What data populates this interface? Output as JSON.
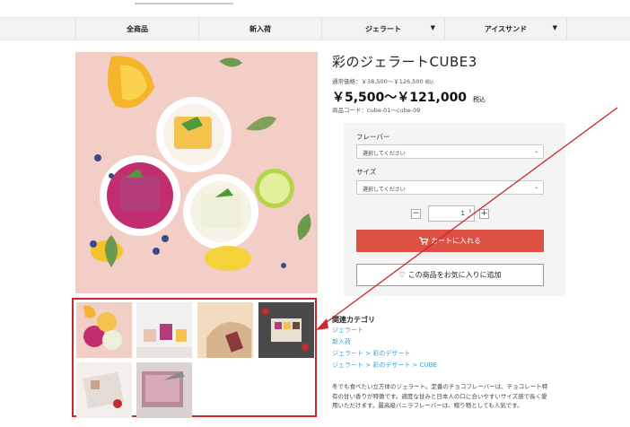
{
  "nav": {
    "items": [
      {
        "label": "全商品",
        "dropdown": false
      },
      {
        "label": "新入荷",
        "dropdown": false
      },
      {
        "label": "ジェラート",
        "dropdown": true
      },
      {
        "label": "アイスサンド",
        "dropdown": true
      }
    ]
  },
  "product": {
    "title": "彩のジェラートCUBE3",
    "regular_price": "通常価格：￥38,500～￥126,500",
    "regular_tax": "税込",
    "price": "￥5,500～￥121,000",
    "price_tax": "税込",
    "code": "商品コード：cube-01～cube-09"
  },
  "form": {
    "flavor_label": "フレーバー",
    "flavor_value": "選択してください",
    "size_label": "サイズ",
    "size_value": "選択してください",
    "quantity": "1",
    "minus": "−",
    "plus": "+",
    "cart_button": "カートに入れる",
    "fav_button": "この商品をお気に入りに追加"
  },
  "related": {
    "heading": "関連カテゴリ",
    "links": [
      "ジェラート",
      "新入荷",
      "ジェラート > 彩のデザート",
      "ジェラート > 彩のデザート > CUBE"
    ]
  },
  "description": "冬でも食べたい立方体のジェラート。定番のチョコフレーバーは、チョコレート特有の甘い香りが特徴です。適度な甘みと日本人の口に合いやすいサイズ感で長く愛用いただけます。最高級バニラフレーバーは、贈り物としても人気です。",
  "icons": {
    "cart": "cart-icon",
    "heart": "heart-icon",
    "caret": "caret-down-icon"
  },
  "colors": {
    "cart_button": "#dd5144",
    "link": "#3aa0d8",
    "highlight_box": "#c8282e"
  }
}
